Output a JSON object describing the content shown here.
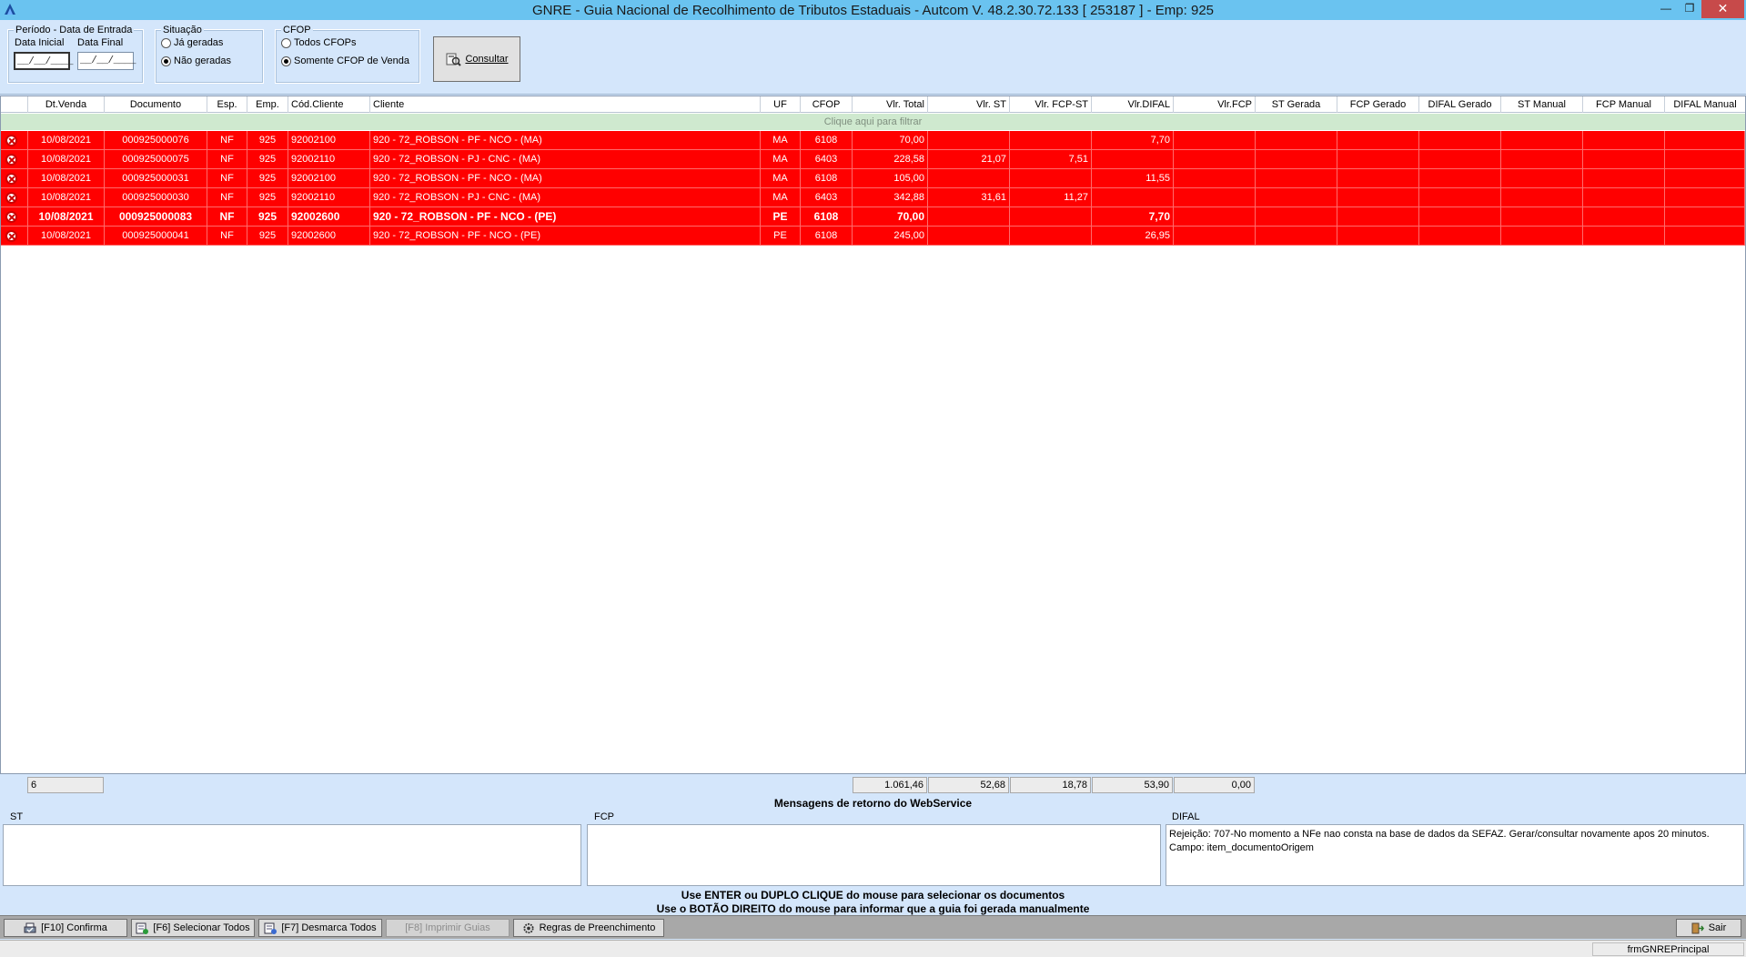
{
  "window": {
    "title": "GNRE - Guia Nacional de Recolhimento de Tributos Estaduais   -   Autcom V. 48.2.30.72.133     [ 253187 ] - Emp: 925",
    "min_glyph": "—",
    "max_glyph": "❐",
    "close_glyph": "✕"
  },
  "filters": {
    "periodo": {
      "title": "Período - Data de Entrada",
      "data_inicial_label": "Data Inicial",
      "data_final_label": "Data Final",
      "data_inicial_value": "__/__/____",
      "data_final_value": "__/__/____"
    },
    "situacao": {
      "title": "Situação",
      "options": [
        {
          "label": "Já geradas",
          "selected": false
        },
        {
          "label": "Não geradas",
          "selected": true
        }
      ]
    },
    "cfop": {
      "title": "CFOP",
      "options": [
        {
          "label": "Todos CFOPs",
          "selected": false
        },
        {
          "label": "Somente CFOP de Venda",
          "selected": true
        }
      ]
    },
    "consultar_label": "Consultar"
  },
  "grid": {
    "columns": [
      "Dt.Venda",
      "Documento",
      "Esp.",
      "Emp.",
      "Cód.Cliente",
      "Cliente",
      "UF",
      "CFOP",
      "Vlr. Total",
      "Vlr. ST",
      "Vlr. FCP-ST",
      "Vlr.DIFAL",
      "Vlr.FCP",
      "ST Gerada",
      "FCP Gerado",
      "DIFAL Gerado",
      "ST Manual",
      "FCP Manual",
      "DIFAL Manual"
    ],
    "filter_hint": "Clique aqui para filtrar",
    "rows": [
      {
        "dt": "10/08/2021",
        "doc": "000925000076",
        "esp": "NF",
        "emp": "925",
        "cod": "92002100",
        "cliente": "920 - 72_ROBSON - PF - NCO - (MA)",
        "uf": "MA",
        "cfop": "6108",
        "total": "70,00",
        "st": "",
        "fcpst": "",
        "difal": "7,70",
        "bold": false
      },
      {
        "dt": "10/08/2021",
        "doc": "000925000075",
        "esp": "NF",
        "emp": "925",
        "cod": "92002110",
        "cliente": "920 - 72_ROBSON - PJ - CNC - (MA)",
        "uf": "MA",
        "cfop": "6403",
        "total": "228,58",
        "st": "21,07",
        "fcpst": "7,51",
        "difal": "",
        "bold": false
      },
      {
        "dt": "10/08/2021",
        "doc": "000925000031",
        "esp": "NF",
        "emp": "925",
        "cod": "92002100",
        "cliente": "920 - 72_ROBSON - PF - NCO - (MA)",
        "uf": "MA",
        "cfop": "6108",
        "total": "105,00",
        "st": "",
        "fcpst": "",
        "difal": "11,55",
        "bold": false
      },
      {
        "dt": "10/08/2021",
        "doc": "000925000030",
        "esp": "NF",
        "emp": "925",
        "cod": "92002110",
        "cliente": "920 - 72_ROBSON - PJ - CNC - (MA)",
        "uf": "MA",
        "cfop": "6403",
        "total": "342,88",
        "st": "31,61",
        "fcpst": "11,27",
        "difal": "",
        "bold": false
      },
      {
        "dt": "10/08/2021",
        "doc": "000925000083",
        "esp": "NF",
        "emp": "925",
        "cod": "92002600",
        "cliente": "920 - 72_ROBSON - PF - NCO - (PE)",
        "uf": "PE",
        "cfop": "6108",
        "total": "70,00",
        "st": "",
        "fcpst": "",
        "difal": "7,70",
        "bold": true
      },
      {
        "dt": "10/08/2021",
        "doc": "000925000041",
        "esp": "NF",
        "emp": "925",
        "cod": "92002600",
        "cliente": "920 - 72_ROBSON - PF - NCO - (PE)",
        "uf": "PE",
        "cfop": "6108",
        "total": "245,00",
        "st": "",
        "fcpst": "",
        "difal": "26,95",
        "bold": false
      }
    ]
  },
  "totals": {
    "count": "6",
    "total": "1.061,46",
    "st": "52,68",
    "fcpst": "18,78",
    "difal": "53,90",
    "fcp": "0,00"
  },
  "messages": {
    "title": "Mensagens de retorno do WebService",
    "st_label": "ST",
    "fcp_label": "FCP",
    "difal_label": "DIFAL",
    "st_text": "",
    "fcp_text": "",
    "difal_text": "Rejeição: 707-No momento a NFe nao consta na base de dados da SEFAZ. Gerar/consultar novamente apos 20 minutos. Campo: item_documentoOrigem"
  },
  "instructions": {
    "line1": "Use ENTER ou DUPLO CLIQUE do mouse para selecionar os documentos",
    "line2": "Use o BOTÃO DIREITO do mouse para informar que a guia foi gerada manualmente"
  },
  "toolbar": {
    "confirma": "[F10] Confirma",
    "selecionar": "[F6] Selecionar Todos",
    "desmarca": "[F7] Desmarca Todos",
    "imprimir": "[F8] Imprimir Guias",
    "regras": "Regras de Preenchimento",
    "sair": "Sair"
  },
  "status": {
    "form_name": "frmGNREPrincipal"
  }
}
